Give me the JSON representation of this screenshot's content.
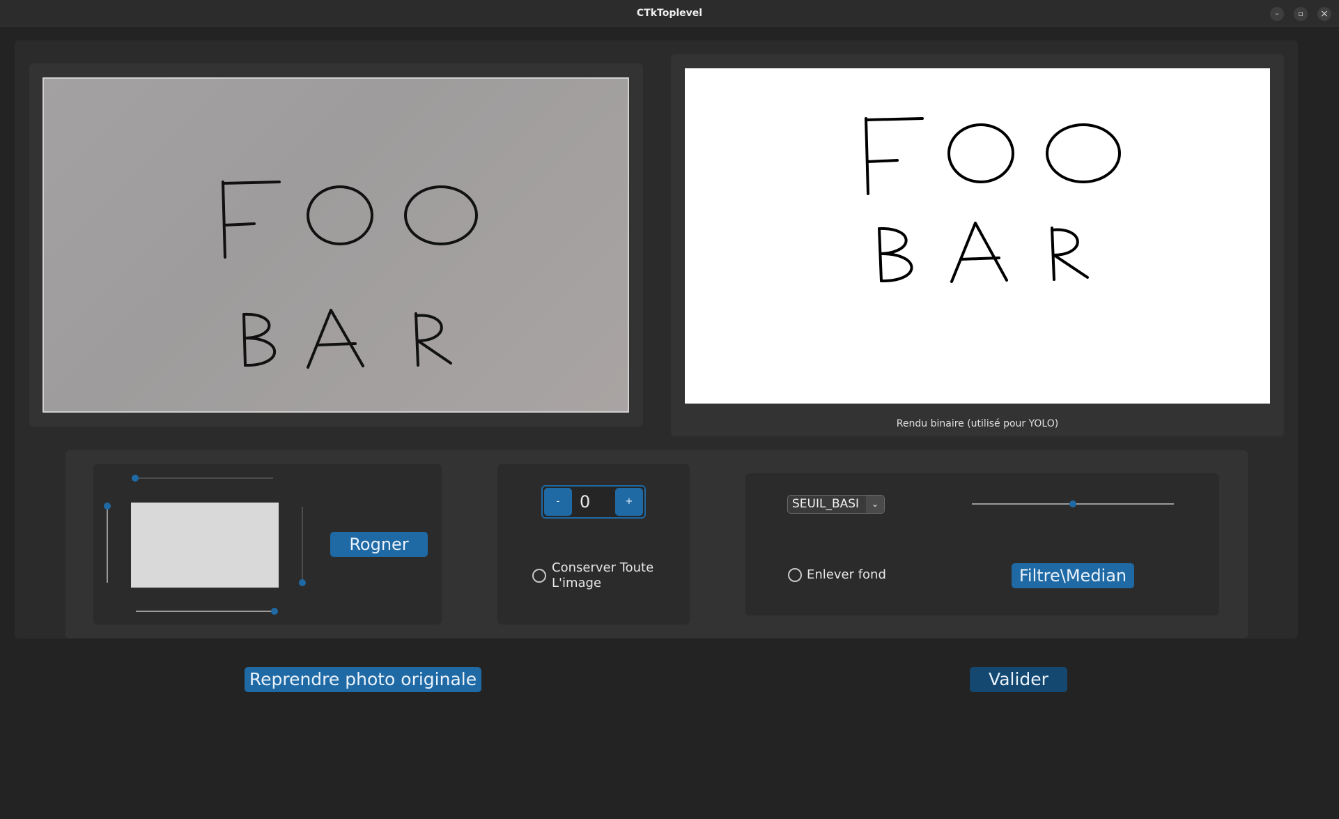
{
  "window": {
    "title": "CTkToplevel",
    "minimize": "–",
    "maximize": "▫",
    "close": "×"
  },
  "preview": {
    "original": {
      "line1": "FOO",
      "line2": "BAR"
    },
    "binary": {
      "line1": "FOO",
      "line2": "BAR",
      "caption": "Rendu binaire (utilisé pour YOLO)"
    }
  },
  "crop": {
    "button": "Rogner"
  },
  "rotation": {
    "minus": "-",
    "value": "0",
    "plus": "+",
    "keep_label_line1": "Conserver Toute",
    "keep_label_line2": "L'image"
  },
  "filter": {
    "method": "SEUIL_BASI",
    "remove_bg_label": "Enlever fond",
    "filter_button": "Filtre\\Median",
    "threshold_fraction": 0.5
  },
  "footer": {
    "reset_button": "Reprendre photo originale",
    "validate_button": "Valider"
  },
  "colors": {
    "accent": "#1f6aa5",
    "accent_dark": "#144870",
    "background": "#232323",
    "panel": "#2b2b2b"
  }
}
